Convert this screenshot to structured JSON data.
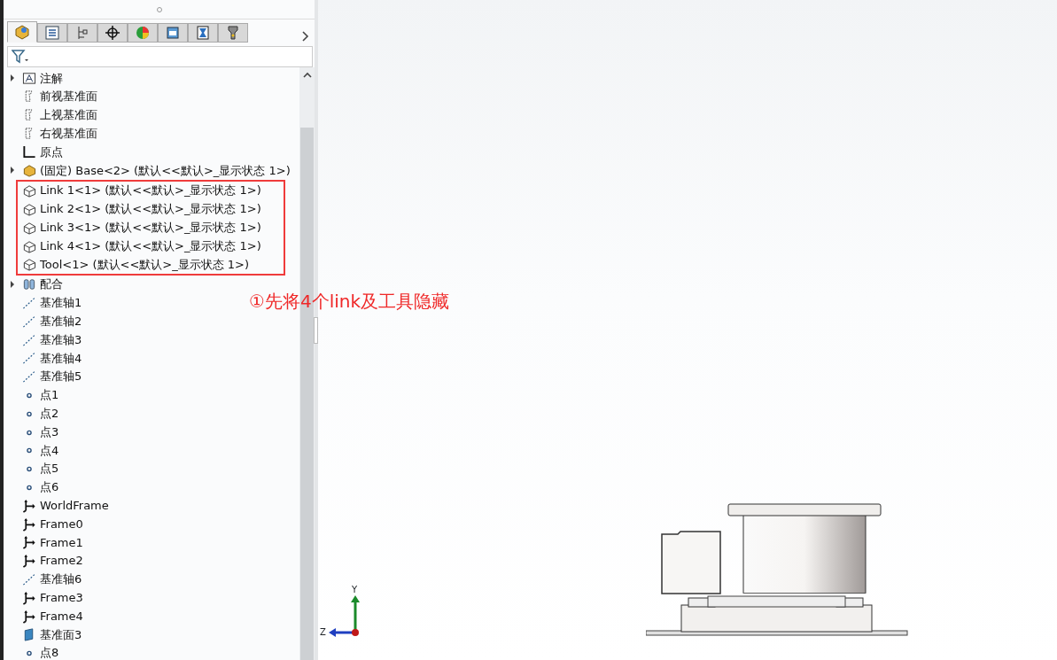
{
  "tabs": [
    {
      "kind": "feature",
      "selected": true
    },
    {
      "kind": "property",
      "selected": false
    },
    {
      "kind": "config",
      "selected": false
    },
    {
      "kind": "dimxpert",
      "selected": false
    },
    {
      "kind": "display",
      "selected": false
    },
    {
      "kind": "cam",
      "selected": false
    },
    {
      "kind": "sim",
      "selected": false
    },
    {
      "kind": "tool",
      "selected": false
    }
  ],
  "tree": [
    {
      "kind": "annotation",
      "label": "注解",
      "expandable": true,
      "boxed": false
    },
    {
      "kind": "plane",
      "label": "前视基准面",
      "expandable": false,
      "boxed": false
    },
    {
      "kind": "plane",
      "label": "上视基准面",
      "expandable": false,
      "boxed": false
    },
    {
      "kind": "plane",
      "label": "右视基准面",
      "expandable": false,
      "boxed": false
    },
    {
      "kind": "origin",
      "label": "原点",
      "expandable": false,
      "boxed": false
    },
    {
      "kind": "fixed-part",
      "label": "(固定) Base<2> (默认<<默认>_显示状态 1>)",
      "expandable": true,
      "boxed": false
    },
    {
      "kind": "part",
      "label": "Link 1<1> (默认<<默认>_显示状态 1>)",
      "expandable": false,
      "boxed": true
    },
    {
      "kind": "part",
      "label": "Link 2<1> (默认<<默认>_显示状态 1>)",
      "expandable": false,
      "boxed": true
    },
    {
      "kind": "part",
      "label": "Link 3<1> (默认<<默认>_显示状态 1>)",
      "expandable": false,
      "boxed": true
    },
    {
      "kind": "part",
      "label": "Link 4<1> (默认<<默认>_显示状态 1>)",
      "expandable": false,
      "boxed": true
    },
    {
      "kind": "part",
      "label": "Tool<1> (默认<<默认>_显示状态 1>)",
      "expandable": false,
      "boxed": true
    },
    {
      "kind": "mates",
      "label": "配合",
      "expandable": true,
      "boxed": false
    },
    {
      "kind": "axis",
      "label": "基准轴1",
      "expandable": false,
      "boxed": false
    },
    {
      "kind": "axis",
      "label": "基准轴2",
      "expandable": false,
      "boxed": false
    },
    {
      "kind": "axis",
      "label": "基准轴3",
      "expandable": false,
      "boxed": false
    },
    {
      "kind": "axis",
      "label": "基准轴4",
      "expandable": false,
      "boxed": false
    },
    {
      "kind": "axis",
      "label": "基准轴5",
      "expandable": false,
      "boxed": false
    },
    {
      "kind": "point",
      "label": "点1",
      "expandable": false,
      "boxed": false
    },
    {
      "kind": "point",
      "label": "点2",
      "expandable": false,
      "boxed": false
    },
    {
      "kind": "point",
      "label": "点3",
      "expandable": false,
      "boxed": false
    },
    {
      "kind": "point",
      "label": "点4",
      "expandable": false,
      "boxed": false
    },
    {
      "kind": "point",
      "label": "点5",
      "expandable": false,
      "boxed": false
    },
    {
      "kind": "point",
      "label": "点6",
      "expandable": false,
      "boxed": false
    },
    {
      "kind": "frame",
      "label": "WorldFrame",
      "expandable": false,
      "boxed": false
    },
    {
      "kind": "frame",
      "label": "Frame0",
      "expandable": false,
      "boxed": false
    },
    {
      "kind": "frame",
      "label": "Frame1",
      "expandable": false,
      "boxed": false
    },
    {
      "kind": "frame",
      "label": "Frame2",
      "expandable": false,
      "boxed": false
    },
    {
      "kind": "axis",
      "label": "基准轴6",
      "expandable": false,
      "boxed": false
    },
    {
      "kind": "frame",
      "label": "Frame3",
      "expandable": false,
      "boxed": false
    },
    {
      "kind": "frame",
      "label": "Frame4",
      "expandable": false,
      "boxed": false
    },
    {
      "kind": "solid-plane",
      "label": "基准面3",
      "expandable": false,
      "boxed": false
    },
    {
      "kind": "point",
      "label": "点8",
      "expandable": false,
      "boxed": false
    }
  ],
  "callout": {
    "text": "①先将4个link及工具隐藏"
  },
  "triad": {
    "y_label": "Y",
    "z_label": "Z"
  }
}
